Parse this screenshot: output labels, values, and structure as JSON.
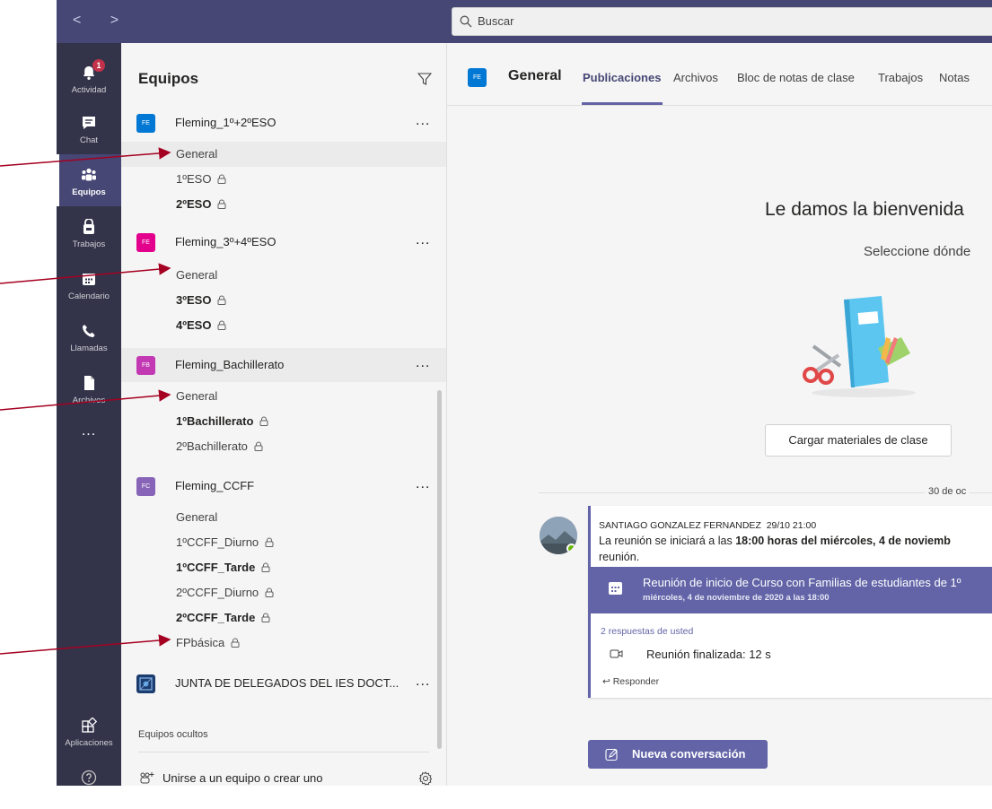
{
  "colors": {
    "rail": "#33344a",
    "topbar": "#464775",
    "accent": "#6264a7",
    "annotation": "#a50021"
  },
  "topbar": {
    "nav": "< >",
    "search_placeholder": "Buscar"
  },
  "rail": {
    "items": [
      {
        "label": "Actividad",
        "icon": "bell-icon",
        "badge": "1"
      },
      {
        "label": "Chat",
        "icon": "chat-icon"
      },
      {
        "label": "Equipos",
        "icon": "teams-icon"
      },
      {
        "label": "Trabajos",
        "icon": "assignments-icon"
      },
      {
        "label": "Calendario",
        "icon": "calendar-icon"
      },
      {
        "label": "Llamadas",
        "icon": "phone-icon"
      },
      {
        "label": "Archivos",
        "icon": "files-icon"
      },
      {
        "label": "...",
        "icon": "more-icon"
      },
      {
        "label": "Aplicaciones",
        "icon": "apps-icon"
      },
      {
        "label": "",
        "icon": "help-icon"
      }
    ]
  },
  "teams": {
    "title": "Equipos",
    "list": [
      {
        "initials": "FE",
        "name": "Fleming_1º+2ºESO",
        "color": "#0078d4",
        "channels": [
          {
            "name": "General"
          },
          {
            "name": "1ºESO"
          },
          {
            "name": "2ºESO"
          }
        ]
      },
      {
        "initials": "FE",
        "name": "Fleming_3º+4ºESO",
        "color": "#e3008c",
        "channels": [
          {
            "name": "General"
          },
          {
            "name": "3ºESO"
          },
          {
            "name": "4ºESO"
          }
        ]
      },
      {
        "initials": "FB",
        "name": "Fleming_Bachillerato",
        "color": "#c239b3",
        "channels": [
          {
            "name": "General"
          },
          {
            "name": "1ºBachillerato"
          },
          {
            "name": "2ºBachillerato"
          }
        ]
      },
      {
        "initials": "FC",
        "name": "Fleming_CCFF",
        "color": "#8764b8",
        "channels": [
          {
            "name": "General"
          },
          {
            "name": "1ºCCFF_Diurno"
          },
          {
            "name": "1ºCCFF_Tarde"
          },
          {
            "name": "2ºCCFF_Diurno"
          },
          {
            "name": "2ºCCFF_Tarde"
          },
          {
            "name": "FPbásica"
          }
        ]
      },
      {
        "initials": "",
        "name": "JUNTA DE DELEGADOS DEL IES DOCT...",
        "color": "#1a3c6e",
        "channels": []
      }
    ],
    "more": "...",
    "hidden_label": "Equipos ocultos",
    "join_label": "Unirse a un equipo o crear uno"
  },
  "main": {
    "avatar": "FE",
    "title": "General",
    "tabs": [
      "Publicaciones",
      "Archivos",
      "Bloc de notas de clase",
      "Trabajos",
      "Notas"
    ],
    "welcome": "Le damos la bienvenida",
    "subwelcome": "Seleccione dónde",
    "upload_label": "Cargar materiales de clase",
    "date_divider": "30 de oc",
    "post": {
      "author": "SANTIAGO GONZALEZ FERNANDEZ",
      "time": "29/10 21:00",
      "body_start": "La reunión se iniciará a las ",
      "body_bold": "18:00 horas del miércoles, 4 de noviemb",
      "body_end": "reunión.",
      "meeting_title": "Reunión de inicio de Curso con Familias de estudiantes de 1º",
      "meeting_date": "miércoles, 4 de noviembre de 2020 a las 18:00",
      "replies": "2 respuestas de usted",
      "ended": "Reunión finalizada: 12 s",
      "reply": "Responder"
    },
    "new_conversation": "Nueva conversación"
  }
}
